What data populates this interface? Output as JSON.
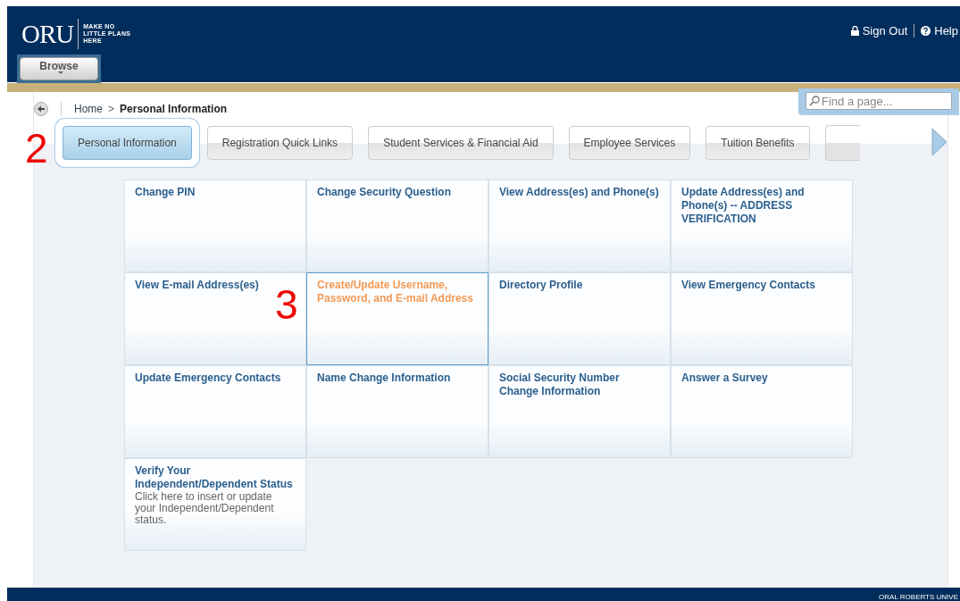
{
  "header": {
    "logo": "ORU",
    "tagline": [
      "MAKE NO",
      "LITTLE PLANS",
      "HERE"
    ],
    "browse": "Browse",
    "links": [
      {
        "kind": "lock",
        "label": "Sign Out"
      },
      {
        "kind": "help",
        "label": "Help"
      }
    ]
  },
  "search": {
    "placeholder": "Find a page..."
  },
  "breadcrumb": {
    "home": "Home",
    "separator": ">",
    "current": "Personal Information"
  },
  "tabs": [
    {
      "label": "Personal Information",
      "selected": true
    },
    {
      "label": "Registration Quick Links",
      "selected": false
    },
    {
      "label": "Student Services & Financial Aid",
      "selected": false
    },
    {
      "label": "Employee Services",
      "selected": false
    },
    {
      "label": "Tuition Benefits",
      "selected": false
    }
  ],
  "tiles": [
    {
      "title": "Change PIN",
      "selected": false
    },
    {
      "title": "Change Security Question",
      "selected": false
    },
    {
      "title": "View Address(es) and Phone(s)",
      "selected": false
    },
    {
      "title": "Update Address(es) and Phone(s) -- ADDRESS VERIFICATION",
      "selected": false
    },
    {
      "title": "View E-mail Address(es)",
      "selected": false
    },
    {
      "title": "Create/Update Username, Password, and E-mail Address",
      "selected": true
    },
    {
      "title": "Directory Profile",
      "selected": false
    },
    {
      "title": "View Emergency Contacts",
      "selected": false
    },
    {
      "title": "Update Emergency Contacts",
      "selected": false
    },
    {
      "title": "Name Change Information",
      "selected": false
    },
    {
      "title": "Social Security Number Change Information",
      "selected": false
    },
    {
      "title": "Answer a Survey",
      "selected": false
    },
    {
      "title": "Verify Your Independent/Dependent Status",
      "description": "Click here to insert or update your Independent/Dependent status.",
      "selected": false
    }
  ],
  "annotations": [
    "2",
    "3"
  ],
  "footer": {
    "text": "ORAL ROBERTS UNIVE"
  }
}
